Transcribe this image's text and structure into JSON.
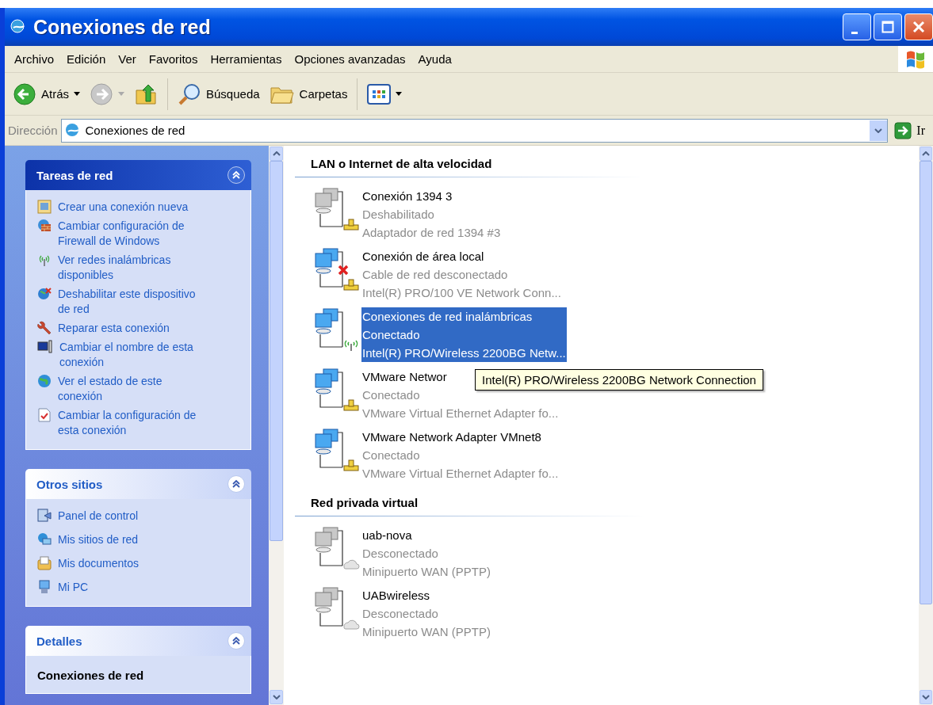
{
  "window": {
    "title": "Conexiones de red"
  },
  "menu": [
    "Archivo",
    "Edición",
    "Ver",
    "Favoritos",
    "Herramientas",
    "Opciones avanzadas",
    "Ayuda"
  ],
  "toolbar": {
    "back": {
      "label": "Atrás",
      "disabled": false
    },
    "forward": {
      "disabled": true
    },
    "search": "Búsqueda",
    "folders": "Carpetas"
  },
  "address": {
    "label": "Dirección",
    "value": "Conexiones de red",
    "go": "Ir"
  },
  "sidebar": [
    {
      "kind": "special",
      "title": "Tareas de red",
      "expanded": true,
      "items": [
        "Crear una conexión nueva",
        "Cambiar configuración de Firewall de Windows",
        "Ver redes inalámbricas disponibles",
        "Deshabilitar este dispositivo de red",
        "Reparar esta conexión",
        "Cambiar el nombre de esta conexión",
        "Ver el estado de este conexión",
        "Cambiar la configuración de esta conexión"
      ]
    },
    {
      "kind": "normal",
      "title": "Otros sitios",
      "expanded": true,
      "items": [
        "Panel de control",
        "Mis sitios de red",
        "Mis documentos",
        "Mi PC"
      ]
    },
    {
      "kind": "normal",
      "title": "Detalles",
      "expanded": true,
      "detail": "Conexiones de red"
    }
  ],
  "groups": [
    {
      "title": "LAN o Internet de alta velocidad",
      "connections": [
        {
          "name": "Conexión 1394 3",
          "status": "Deshabilitado",
          "device": "Adaptador de red 1394 #3",
          "kind": "lan",
          "active": false,
          "unplugged": false,
          "selected": false
        },
        {
          "name": "Conexión de área local",
          "status": "Cable de red desconectado",
          "device": "Intel(R) PRO/100 VE Network Conn...",
          "kind": "lan",
          "active": true,
          "unplugged": true,
          "selected": false
        },
        {
          "name": "Conexiones de red inalámbricas",
          "status": "Conectado",
          "device": "Intel(R) PRO/Wireless 2200BG Netw...",
          "kind": "wireless",
          "active": true,
          "unplugged": false,
          "selected": true
        },
        {
          "name": "VMware Networ",
          "status": "Conectado",
          "device": "VMware Virtual Ethernet Adapter fo...",
          "kind": "lan",
          "active": true,
          "unplugged": false,
          "selected": false
        },
        {
          "name": "VMware Network Adapter VMnet8",
          "status": "Conectado",
          "device": "VMware Virtual Ethernet Adapter fo...",
          "kind": "lan",
          "active": true,
          "unplugged": false,
          "selected": false
        }
      ]
    },
    {
      "title": "Red privada virtual",
      "connections": [
        {
          "name": "uab-nova",
          "status": "Desconectado",
          "device": "Minipuerto WAN (PPTP)",
          "kind": "vpn",
          "active": false,
          "unplugged": false,
          "selected": false
        },
        {
          "name": "UABwireless",
          "status": "Desconectado",
          "device": "Minipuerto WAN (PPTP)",
          "kind": "vpn",
          "active": false,
          "unplugged": false,
          "selected": false
        }
      ]
    }
  ],
  "tooltip": "Intel(R) PRO/Wireless 2200BG Network Connection"
}
